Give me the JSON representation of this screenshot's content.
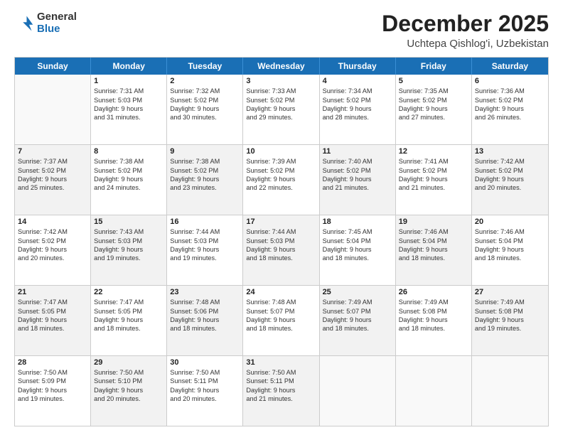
{
  "logo": {
    "general": "General",
    "blue": "Blue"
  },
  "header": {
    "month": "December 2025",
    "location": "Uchtepa Qishlog'i, Uzbekistan"
  },
  "weekdays": [
    "Sunday",
    "Monday",
    "Tuesday",
    "Wednesday",
    "Thursday",
    "Friday",
    "Saturday"
  ],
  "rows": [
    [
      {
        "day": "",
        "lines": [],
        "empty": true
      },
      {
        "day": "1",
        "lines": [
          "Sunrise: 7:31 AM",
          "Sunset: 5:03 PM",
          "Daylight: 9 hours",
          "and 31 minutes."
        ]
      },
      {
        "day": "2",
        "lines": [
          "Sunrise: 7:32 AM",
          "Sunset: 5:02 PM",
          "Daylight: 9 hours",
          "and 30 minutes."
        ]
      },
      {
        "day": "3",
        "lines": [
          "Sunrise: 7:33 AM",
          "Sunset: 5:02 PM",
          "Daylight: 9 hours",
          "and 29 minutes."
        ]
      },
      {
        "day": "4",
        "lines": [
          "Sunrise: 7:34 AM",
          "Sunset: 5:02 PM",
          "Daylight: 9 hours",
          "and 28 minutes."
        ]
      },
      {
        "day": "5",
        "lines": [
          "Sunrise: 7:35 AM",
          "Sunset: 5:02 PM",
          "Daylight: 9 hours",
          "and 27 minutes."
        ]
      },
      {
        "day": "6",
        "lines": [
          "Sunrise: 7:36 AM",
          "Sunset: 5:02 PM",
          "Daylight: 9 hours",
          "and 26 minutes."
        ]
      }
    ],
    [
      {
        "day": "7",
        "lines": [
          "Sunrise: 7:37 AM",
          "Sunset: 5:02 PM",
          "Daylight: 9 hours",
          "and 25 minutes."
        ],
        "shaded": true
      },
      {
        "day": "8",
        "lines": [
          "Sunrise: 7:38 AM",
          "Sunset: 5:02 PM",
          "Daylight: 9 hours",
          "and 24 minutes."
        ]
      },
      {
        "day": "9",
        "lines": [
          "Sunrise: 7:38 AM",
          "Sunset: 5:02 PM",
          "Daylight: 9 hours",
          "and 23 minutes."
        ],
        "shaded": true
      },
      {
        "day": "10",
        "lines": [
          "Sunrise: 7:39 AM",
          "Sunset: 5:02 PM",
          "Daylight: 9 hours",
          "and 22 minutes."
        ]
      },
      {
        "day": "11",
        "lines": [
          "Sunrise: 7:40 AM",
          "Sunset: 5:02 PM",
          "Daylight: 9 hours",
          "and 21 minutes."
        ],
        "shaded": true
      },
      {
        "day": "12",
        "lines": [
          "Sunrise: 7:41 AM",
          "Sunset: 5:02 PM",
          "Daylight: 9 hours",
          "and 21 minutes."
        ]
      },
      {
        "day": "13",
        "lines": [
          "Sunrise: 7:42 AM",
          "Sunset: 5:02 PM",
          "Daylight: 9 hours",
          "and 20 minutes."
        ],
        "shaded": true
      }
    ],
    [
      {
        "day": "14",
        "lines": [
          "Sunrise: 7:42 AM",
          "Sunset: 5:02 PM",
          "Daylight: 9 hours",
          "and 20 minutes."
        ]
      },
      {
        "day": "15",
        "lines": [
          "Sunrise: 7:43 AM",
          "Sunset: 5:03 PM",
          "Daylight: 9 hours",
          "and 19 minutes."
        ],
        "shaded": true
      },
      {
        "day": "16",
        "lines": [
          "Sunrise: 7:44 AM",
          "Sunset: 5:03 PM",
          "Daylight: 9 hours",
          "and 19 minutes."
        ]
      },
      {
        "day": "17",
        "lines": [
          "Sunrise: 7:44 AM",
          "Sunset: 5:03 PM",
          "Daylight: 9 hours",
          "and 18 minutes."
        ],
        "shaded": true
      },
      {
        "day": "18",
        "lines": [
          "Sunrise: 7:45 AM",
          "Sunset: 5:04 PM",
          "Daylight: 9 hours",
          "and 18 minutes."
        ]
      },
      {
        "day": "19",
        "lines": [
          "Sunrise: 7:46 AM",
          "Sunset: 5:04 PM",
          "Daylight: 9 hours",
          "and 18 minutes."
        ],
        "shaded": true
      },
      {
        "day": "20",
        "lines": [
          "Sunrise: 7:46 AM",
          "Sunset: 5:04 PM",
          "Daylight: 9 hours",
          "and 18 minutes."
        ]
      }
    ],
    [
      {
        "day": "21",
        "lines": [
          "Sunrise: 7:47 AM",
          "Sunset: 5:05 PM",
          "Daylight: 9 hours",
          "and 18 minutes."
        ],
        "shaded": true
      },
      {
        "day": "22",
        "lines": [
          "Sunrise: 7:47 AM",
          "Sunset: 5:05 PM",
          "Daylight: 9 hours",
          "and 18 minutes."
        ]
      },
      {
        "day": "23",
        "lines": [
          "Sunrise: 7:48 AM",
          "Sunset: 5:06 PM",
          "Daylight: 9 hours",
          "and 18 minutes."
        ],
        "shaded": true
      },
      {
        "day": "24",
        "lines": [
          "Sunrise: 7:48 AM",
          "Sunset: 5:07 PM",
          "Daylight: 9 hours",
          "and 18 minutes."
        ]
      },
      {
        "day": "25",
        "lines": [
          "Sunrise: 7:49 AM",
          "Sunset: 5:07 PM",
          "Daylight: 9 hours",
          "and 18 minutes."
        ],
        "shaded": true
      },
      {
        "day": "26",
        "lines": [
          "Sunrise: 7:49 AM",
          "Sunset: 5:08 PM",
          "Daylight: 9 hours",
          "and 18 minutes."
        ]
      },
      {
        "day": "27",
        "lines": [
          "Sunrise: 7:49 AM",
          "Sunset: 5:08 PM",
          "Daylight: 9 hours",
          "and 19 minutes."
        ],
        "shaded": true
      }
    ],
    [
      {
        "day": "28",
        "lines": [
          "Sunrise: 7:50 AM",
          "Sunset: 5:09 PM",
          "Daylight: 9 hours",
          "and 19 minutes."
        ]
      },
      {
        "day": "29",
        "lines": [
          "Sunrise: 7:50 AM",
          "Sunset: 5:10 PM",
          "Daylight: 9 hours",
          "and 20 minutes."
        ],
        "shaded": true
      },
      {
        "day": "30",
        "lines": [
          "Sunrise: 7:50 AM",
          "Sunset: 5:11 PM",
          "Daylight: 9 hours",
          "and 20 minutes."
        ]
      },
      {
        "day": "31",
        "lines": [
          "Sunrise: 7:50 AM",
          "Sunset: 5:11 PM",
          "Daylight: 9 hours",
          "and 21 minutes."
        ],
        "shaded": true
      },
      {
        "day": "",
        "lines": [],
        "empty": true
      },
      {
        "day": "",
        "lines": [],
        "empty": true
      },
      {
        "day": "",
        "lines": [],
        "empty": true
      }
    ]
  ]
}
